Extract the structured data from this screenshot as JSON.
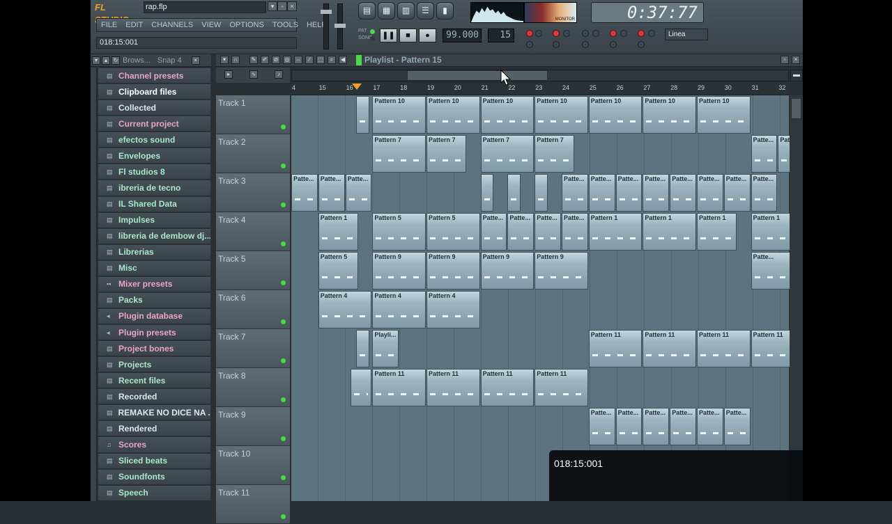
{
  "app": {
    "logo": "FL STUDIO",
    "filename": "rap.flp",
    "hint": "018:15:001"
  },
  "menu": [
    "FILE",
    "EDIT",
    "CHANNELS",
    "VIEW",
    "OPTIONS",
    "TOOLS",
    "HELP"
  ],
  "transport": {
    "time": "0:37:77",
    "tempo": "99.000",
    "pattern": "15",
    "pat_label": "PAT",
    "song_label": "SONG",
    "monitor_label": "MONITOR",
    "snap": "Linea"
  },
  "browser": {
    "title": "Brows...",
    "snap": "Snap 4",
    "items": [
      {
        "label": "Channel presets",
        "color": "p",
        "icon": "folder"
      },
      {
        "label": "Clipboard files",
        "color": "s",
        "icon": "folder"
      },
      {
        "label": "Collected",
        "color": "w",
        "icon": "folder"
      },
      {
        "label": "Current project",
        "color": "p",
        "icon": "folder"
      },
      {
        "label": "efectos sound",
        "color": "g",
        "icon": "folder"
      },
      {
        "label": "Envelopes",
        "color": "g",
        "icon": "folder"
      },
      {
        "label": "Fl studios 8",
        "color": "g",
        "icon": "folder"
      },
      {
        "label": "ibreria de tecno",
        "color": "g",
        "icon": "folder"
      },
      {
        "label": "IL Shared Data",
        "color": "g",
        "icon": "folder"
      },
      {
        "label": "Impulses",
        "color": "g",
        "icon": "folder"
      },
      {
        "label": "libreria de dembow dj...",
        "color": "g",
        "icon": "folder"
      },
      {
        "label": "Librerias",
        "color": "g",
        "icon": "folder"
      },
      {
        "label": "Misc",
        "color": "g",
        "icon": "folder"
      },
      {
        "label": "Mixer presets",
        "color": "p",
        "icon": "mixer"
      },
      {
        "label": "Packs",
        "color": "g",
        "icon": "folder"
      },
      {
        "label": "Plugin database",
        "color": "p",
        "icon": "plugin"
      },
      {
        "label": "Plugin presets",
        "color": "p",
        "icon": "plugin"
      },
      {
        "label": "Project bones",
        "color": "p",
        "icon": "folder"
      },
      {
        "label": "Projects",
        "color": "g",
        "icon": "folder"
      },
      {
        "label": "Recent files",
        "color": "g",
        "icon": "folder"
      },
      {
        "label": "Recorded",
        "color": "w",
        "icon": "folder"
      },
      {
        "label": "REMAKE NO DICE NA ...",
        "color": "w",
        "icon": "folder"
      },
      {
        "label": "Rendered",
        "color": "w",
        "icon": "folder"
      },
      {
        "label": "Scores",
        "color": "p",
        "icon": "note"
      },
      {
        "label": "Sliced beats",
        "color": "g",
        "icon": "folder"
      },
      {
        "label": "Soundfonts",
        "color": "g",
        "icon": "folder"
      },
      {
        "label": "Speech",
        "color": "g",
        "icon": "folder"
      }
    ]
  },
  "playlist": {
    "title": "Playlist - Pattern 15",
    "ruler": [
      "4",
      "15",
      "16",
      "17",
      "18",
      "19",
      "20",
      "21",
      "22",
      "23",
      "24",
      "25",
      "26",
      "27",
      "28",
      "29",
      "30",
      "31",
      "32"
    ],
    "tracks": [
      "Track 1",
      "Track 2",
      "Track 3",
      "Track 4",
      "Track 5",
      "Track 6",
      "Track 7",
      "Track 8",
      "Track 9",
      "Track 10",
      "Track 11"
    ],
    "patterns": [
      {
        "track": 0,
        "bar": 16.4,
        "len": 0.5,
        "label": ""
      },
      {
        "track": 0,
        "bar": 17,
        "len": 2,
        "label": "Pattern 10"
      },
      {
        "track": 0,
        "bar": 19,
        "len": 2,
        "label": "Pattern 10"
      },
      {
        "track": 0,
        "bar": 21,
        "len": 2,
        "label": "Pattern 10"
      },
      {
        "track": 0,
        "bar": 23,
        "len": 2,
        "label": "Pattern 10"
      },
      {
        "track": 0,
        "bar": 25,
        "len": 2,
        "label": "Pattern 10"
      },
      {
        "track": 0,
        "bar": 27,
        "len": 2,
        "label": "Pattern 10"
      },
      {
        "track": 0,
        "bar": 29,
        "len": 2,
        "label": "Pattern 10"
      },
      {
        "track": 1,
        "bar": 17,
        "len": 2,
        "label": "Pattern 7"
      },
      {
        "track": 1,
        "bar": 19,
        "len": 1.5,
        "label": "Pattern 7"
      },
      {
        "track": 1,
        "bar": 21,
        "len": 2,
        "label": "Pattern 7"
      },
      {
        "track": 1,
        "bar": 23,
        "len": 1.5,
        "label": "Pattern 7"
      },
      {
        "track": 1,
        "bar": 31,
        "len": 1,
        "label": "Patte..."
      },
      {
        "track": 1,
        "bar": 32,
        "len": 0.5,
        "label": "Pat"
      },
      {
        "track": 2,
        "bar": 14,
        "len": 1,
        "label": "Patte..."
      },
      {
        "track": 2,
        "bar": 15,
        "len": 1,
        "label": "Patte..."
      },
      {
        "track": 2,
        "bar": 16,
        "len": 1,
        "label": "Patte..."
      },
      {
        "track": 2,
        "bar": 21,
        "len": 0.5,
        "label": ""
      },
      {
        "track": 2,
        "bar": 22,
        "len": 0.5,
        "label": ""
      },
      {
        "track": 2,
        "bar": 23,
        "len": 0.5,
        "label": ""
      },
      {
        "track": 2,
        "bar": 24,
        "len": 1,
        "label": "Patte..."
      },
      {
        "track": 2,
        "bar": 25,
        "len": 1,
        "label": "Patte..."
      },
      {
        "track": 2,
        "bar": 26,
        "len": 1,
        "label": "Patte..."
      },
      {
        "track": 2,
        "bar": 27,
        "len": 1,
        "label": "Patte..."
      },
      {
        "track": 2,
        "bar": 28,
        "len": 1,
        "label": "Patte..."
      },
      {
        "track": 2,
        "bar": 29,
        "len": 1,
        "label": "Patte..."
      },
      {
        "track": 2,
        "bar": 30,
        "len": 1,
        "label": "Patte..."
      },
      {
        "track": 2,
        "bar": 31,
        "len": 1,
        "label": "Patte..."
      },
      {
        "track": 3,
        "bar": 15,
        "len": 1.5,
        "label": "Pattern 1"
      },
      {
        "track": 3,
        "bar": 17,
        "len": 2,
        "label": "Pattern 5"
      },
      {
        "track": 3,
        "bar": 19,
        "len": 2,
        "label": "Pattern 5"
      },
      {
        "track": 3,
        "bar": 21,
        "len": 1,
        "label": "Patte..."
      },
      {
        "track": 3,
        "bar": 22,
        "len": 1,
        "label": "Patte..."
      },
      {
        "track": 3,
        "bar": 23,
        "len": 1,
        "label": "Patte..."
      },
      {
        "track": 3,
        "bar": 24,
        "len": 1,
        "label": "Patte..."
      },
      {
        "track": 3,
        "bar": 25,
        "len": 2,
        "label": "Pattern 1"
      },
      {
        "track": 3,
        "bar": 27,
        "len": 2,
        "label": "Pattern 1"
      },
      {
        "track": 3,
        "bar": 29,
        "len": 1.5,
        "label": "Pattern 1"
      },
      {
        "track": 3,
        "bar": 31,
        "len": 1.5,
        "label": "Pattern 1"
      },
      {
        "track": 4,
        "bar": 15,
        "len": 1.5,
        "label": "Pattern 5"
      },
      {
        "track": 4,
        "bar": 17,
        "len": 2,
        "label": "Pattern 9"
      },
      {
        "track": 4,
        "bar": 19,
        "len": 2,
        "label": "Pattern 9"
      },
      {
        "track": 4,
        "bar": 21,
        "len": 2,
        "label": "Pattern 9"
      },
      {
        "track": 4,
        "bar": 23,
        "len": 2,
        "label": "Pattern 9"
      },
      {
        "track": 4,
        "bar": 31,
        "len": 1.5,
        "label": "Patte..."
      },
      {
        "track": 5,
        "bar": 15,
        "len": 2,
        "label": "Pattern 4"
      },
      {
        "track": 5,
        "bar": 17,
        "len": 2,
        "label": "Pattern 4"
      },
      {
        "track": 5,
        "bar": 19,
        "len": 2,
        "label": "Pattern 4"
      },
      {
        "track": 6,
        "bar": 16.4,
        "len": 0.5,
        "label": ""
      },
      {
        "track": 6,
        "bar": 17,
        "len": 1,
        "label": "Playli..."
      },
      {
        "track": 6,
        "bar": 25,
        "len": 2,
        "label": "Pattern 11"
      },
      {
        "track": 6,
        "bar": 27,
        "len": 2,
        "label": "Pattern 11"
      },
      {
        "track": 6,
        "bar": 29,
        "len": 2,
        "label": "Pattern 11"
      },
      {
        "track": 6,
        "bar": 31,
        "len": 1.5,
        "label": "Pattern 11"
      },
      {
        "track": 7,
        "bar": 16.2,
        "len": 0.8,
        "label": ""
      },
      {
        "track": 7,
        "bar": 17,
        "len": 2,
        "label": "Pattern 11"
      },
      {
        "track": 7,
        "bar": 19,
        "len": 2,
        "label": "Pattern 11"
      },
      {
        "track": 7,
        "bar": 21,
        "len": 2,
        "label": "Pattern 11"
      },
      {
        "track": 7,
        "bar": 23,
        "len": 2,
        "label": "Pattern 11"
      },
      {
        "track": 8,
        "bar": 25,
        "len": 1,
        "label": "Patte..."
      },
      {
        "track": 8,
        "bar": 26,
        "len": 1,
        "label": "Patte..."
      },
      {
        "track": 8,
        "bar": 27,
        "len": 1,
        "label": "Patte..."
      },
      {
        "track": 8,
        "bar": 28,
        "len": 1,
        "label": "Patte..."
      },
      {
        "track": 8,
        "bar": 29,
        "len": 1,
        "label": "Patte..."
      },
      {
        "track": 8,
        "bar": 30,
        "len": 1,
        "label": "Patte..."
      }
    ]
  },
  "overlay": {
    "time": "018:15:001"
  }
}
